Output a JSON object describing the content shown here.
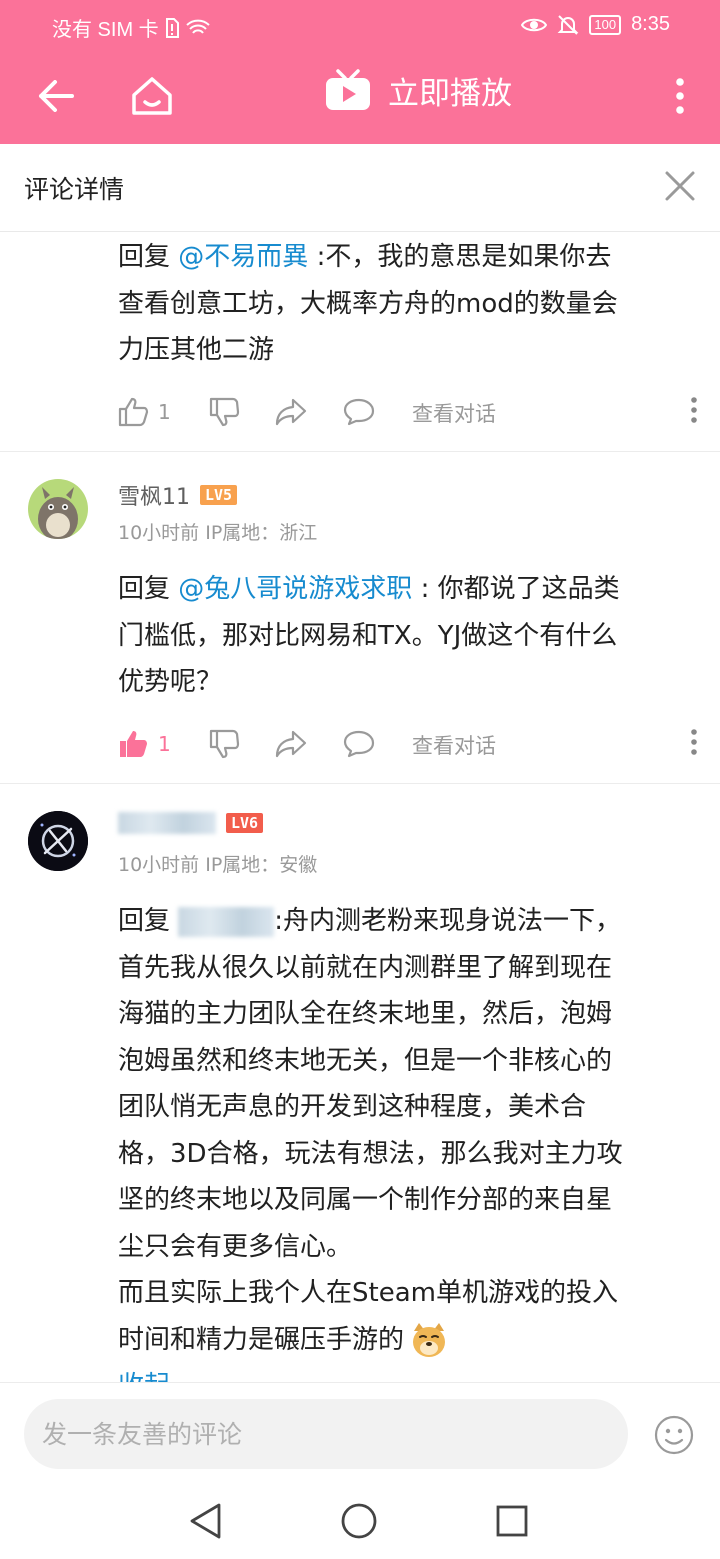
{
  "status_bar": {
    "carrier": "没有 SIM 卡",
    "battery": "100",
    "time": "8:35"
  },
  "app_bar": {
    "play_now_label": "立即播放"
  },
  "sheet": {
    "title": "评论详情"
  },
  "comments": [
    {
      "reply_prefix": "回复",
      "mention": "@不易而異",
      "text_lines": [
        ":不，我的意思是如果你去",
        "查看创意工坊，大概率方舟的mod的数量会",
        "力压其他二游"
      ],
      "likes": "1",
      "view_conversation": "查看对话"
    },
    {
      "username": "雪枫11",
      "level": "LV5",
      "time": "10小时前",
      "ip": "IP属地：浙江",
      "reply_prefix": "回复",
      "mention": "@兔八哥说游戏求职",
      "text_lines": [
        ": 你都说了这品类",
        "门槛低，那对比网易和TX。YJ做这个有什么",
        "优势呢？"
      ],
      "likes": "1",
      "view_conversation": "查看对话"
    },
    {
      "level": "LV6",
      "time": "10小时前",
      "ip": "IP属地：安徽",
      "reply_prefix": "回复",
      "text_lines": [
        ":舟内测老粉来现身说法一下，",
        "首先我从很久以前就在内测群里了解到现在",
        "海猫的主力团队全在终末地里，然后，泡姆",
        "泡姆虽然和终末地无关，但是一个非核心的",
        "团队悄无声息的开发到这种程度，美术合",
        "格，3D合格，玩法有想法，那么我对主力攻",
        "坚的终末地以及同属一个制作分部的来自星",
        "尘只会有更多信心。",
        "而且实际上我个人在Steam单机游戏的投入",
        "时间和精力是碾压手游的"
      ],
      "collapse": "收起"
    }
  ],
  "input": {
    "placeholder": "发一条友善的评论"
  },
  "colors": {
    "brand_pink": "#fb7299",
    "mention_blue": "#178bcf",
    "lv5_orange": "#f8a14e",
    "lv6_red": "#f25d4c"
  },
  "icons": [
    "back-arrow-icon",
    "home-icon",
    "tv-play-icon",
    "more-vert-icon",
    "close-icon",
    "thumb-up-icon",
    "thumb-down-icon",
    "share-icon",
    "comment-icon",
    "emoji-icon",
    "doge-emoji-icon",
    "nav-back-icon",
    "nav-home-icon",
    "nav-recents-icon"
  ]
}
